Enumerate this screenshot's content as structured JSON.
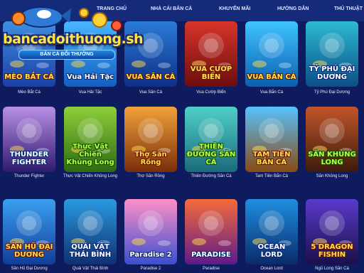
{
  "logo": {
    "text": "bancadoithuong.sh",
    "tagline": "BẮN CÁ ĐỔI THƯỞNG"
  },
  "nav": {
    "items": [
      {
        "label": "TRANG CHỦ"
      },
      {
        "label": "NHÀ CÁI BẮN CÁ"
      },
      {
        "label": "KHUYẾN MÃI"
      },
      {
        "label": "HƯỚNG DẪN"
      },
      {
        "label": "THỦ THUẬT"
      }
    ]
  },
  "colors": {
    "background": "#0e1b5e",
    "nav_bg": "#162a7a",
    "title_gold": "#ffe14a"
  },
  "games": [
    {
      "name": "Mèo Bắt Cá",
      "art_title": "MÈO BẮT CÁ",
      "bg1": "#3f8fe0",
      "bg2": "#1b3fa8"
    },
    {
      "name": "Vua Hải Tặc",
      "art_title": "Vua Hải Tặc",
      "bg1": "#48b6ff",
      "bg2": "#125fc2"
    },
    {
      "name": "Vua Săn Cá",
      "art_title": "VUA SĂN CÁ",
      "bg1": "#2a7bd8",
      "bg2": "#0e2f85"
    },
    {
      "name": "Vua Cướp Biển",
      "art_title": "VUA CƯỚP BIỂN",
      "bg1": "#d8342a",
      "bg2": "#6b0e0e"
    },
    {
      "name": "Vua Bắn Cá",
      "art_title": "VUA BẮN CÁ",
      "bg1": "#3fc4ff",
      "bg2": "#0b5fb0"
    },
    {
      "name": "Tỷ Phú Đại Dương",
      "art_title": "TỶ PHÚ ĐẠI DƯƠNG",
      "bg1": "#2dbad2",
      "bg2": "#0a4f87"
    },
    {
      "name": "Thunder Fighter",
      "art_title": "THUNDER FIGHTER",
      "bg1": "#b88fe6",
      "bg2": "#2f1a6e"
    },
    {
      "name": "Thực Vật Chiến Khủng Long",
      "art_title": "Thực Vật Chiến Khủng Long",
      "bg1": "#8fcf3a",
      "bg2": "#2c6b12"
    },
    {
      "name": "Thợ Săn Rồng",
      "art_title": "Thợ Săn Rồng",
      "bg1": "#f2a23a",
      "bg2": "#7a2e0a"
    },
    {
      "name": "Thiên Đường Săn Cá",
      "art_title": "THIÊN ĐƯỜNG SĂN CÁ",
      "bg1": "#4fd0c8",
      "bg2": "#1a6b7a"
    },
    {
      "name": "Tam Tiên Bắn Cá",
      "art_title": "TAM TIÊN BẮN CÁ",
      "bg1": "#55c3ff",
      "bg2": "#8a4a12"
    },
    {
      "name": "Săn Khủng Long",
      "art_title": "SĂN KHỦNG LONG",
      "bg1": "#c2552a",
      "bg2": "#3d1a0c"
    },
    {
      "name": "Sân Hũ Đại Dương",
      "art_title": "SĂN HŨ ĐẠI DƯƠNG",
      "bg1": "#3aa0f0",
      "bg2": "#123d9a"
    },
    {
      "name": "Quái Vật Thái Bình",
      "art_title": "QUÁI VẬT THÁI BÌNH",
      "bg1": "#2a9ae0",
      "bg2": "#0e3070"
    },
    {
      "name": "Paradise 2",
      "art_title": "Paradise 2",
      "bg1": "#ff8fc7",
      "bg2": "#3a4fd0"
    },
    {
      "name": "Paradise",
      "art_title": "PARADISE",
      "bg1": "#f56b3a",
      "bg2": "#5e1a8a"
    },
    {
      "name": "Ocean Lord",
      "art_title": "OCEAN LORD",
      "bg1": "#1e8fe0",
      "bg2": "#0a2a6b"
    },
    {
      "name": "Ngũ Long Săn Cá",
      "art_title": "5 DRAGON FISHIN",
      "bg1": "#5a3acb",
      "bg2": "#1a0f4a"
    }
  ]
}
